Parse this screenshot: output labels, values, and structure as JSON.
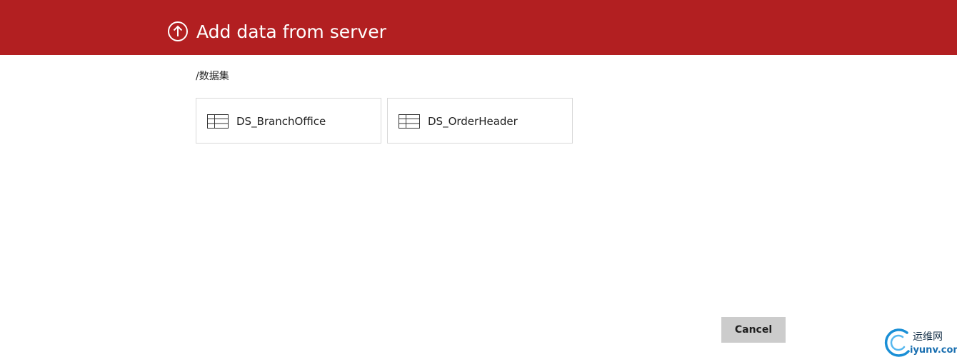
{
  "header": {
    "title": "Add data from server",
    "icon": "upload-arrow-circle-icon",
    "background_color": "#b21f21",
    "text_color": "#ffffff"
  },
  "breadcrumb": {
    "path": "/数据集"
  },
  "datasets": [
    {
      "label": "DS_BranchOffice",
      "icon": "table-icon"
    },
    {
      "label": "DS_OrderHeader",
      "icon": "table-icon"
    }
  ],
  "footer": {
    "cancel_label": "Cancel",
    "cancel_color": "#cccccc"
  },
  "watermark": {
    "cn_text": "运维网",
    "domain_text": "iyunv.com"
  }
}
